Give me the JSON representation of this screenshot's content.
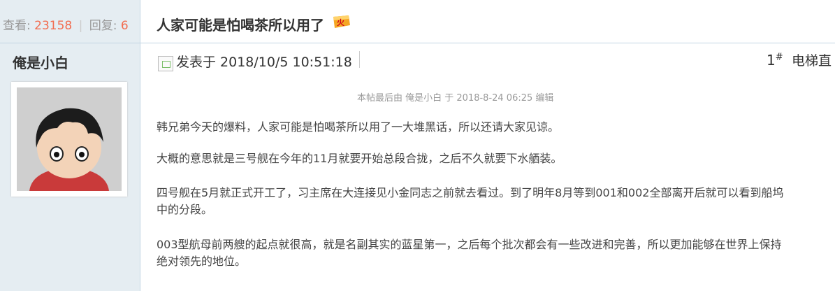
{
  "thread": {
    "views_label": "查看:",
    "views": "23158",
    "separator": "|",
    "replies_label": "回复:",
    "replies": "6",
    "title": "人家可能是怕喝茶所以用了"
  },
  "author": {
    "name": "俺是小白"
  },
  "post": {
    "time": "发表于 2018/10/5 10:51:18",
    "floor_number": "1",
    "floor_mark": "#",
    "elevator_label": "电梯直",
    "edit_note": "本帖最后由 俺是小白 于 2018-8-24 06:25 编辑",
    "paragraphs": [
      "韩兄弟今天的爆料，人家可能是怕喝茶所以用了一大堆黑话，所以还请大家见谅。",
      "大概的意思就是三号舰在今年的11月就要开始总段合拢，之后不久就要下水舾装。",
      "四号舰在5月就正式开工了，习主席在大连接见小金同志之前就去看过。到了明年8月等到001和002全部离开后就可以看到船坞中的分段。",
      "003型航母前两艘的起点就很高，就是名副其实的蓝星第一，之后每个批次都会有一些改进和完善，所以更加能够在世界上保持绝对领先的地位。"
    ]
  },
  "icons": {
    "hot": "hot-thread-icon",
    "broken_image": "broken-image-icon"
  },
  "colors": {
    "sidebar_bg": "#e5edf2",
    "border": "#c2d5e3",
    "number_orange": "#f26c4f"
  }
}
